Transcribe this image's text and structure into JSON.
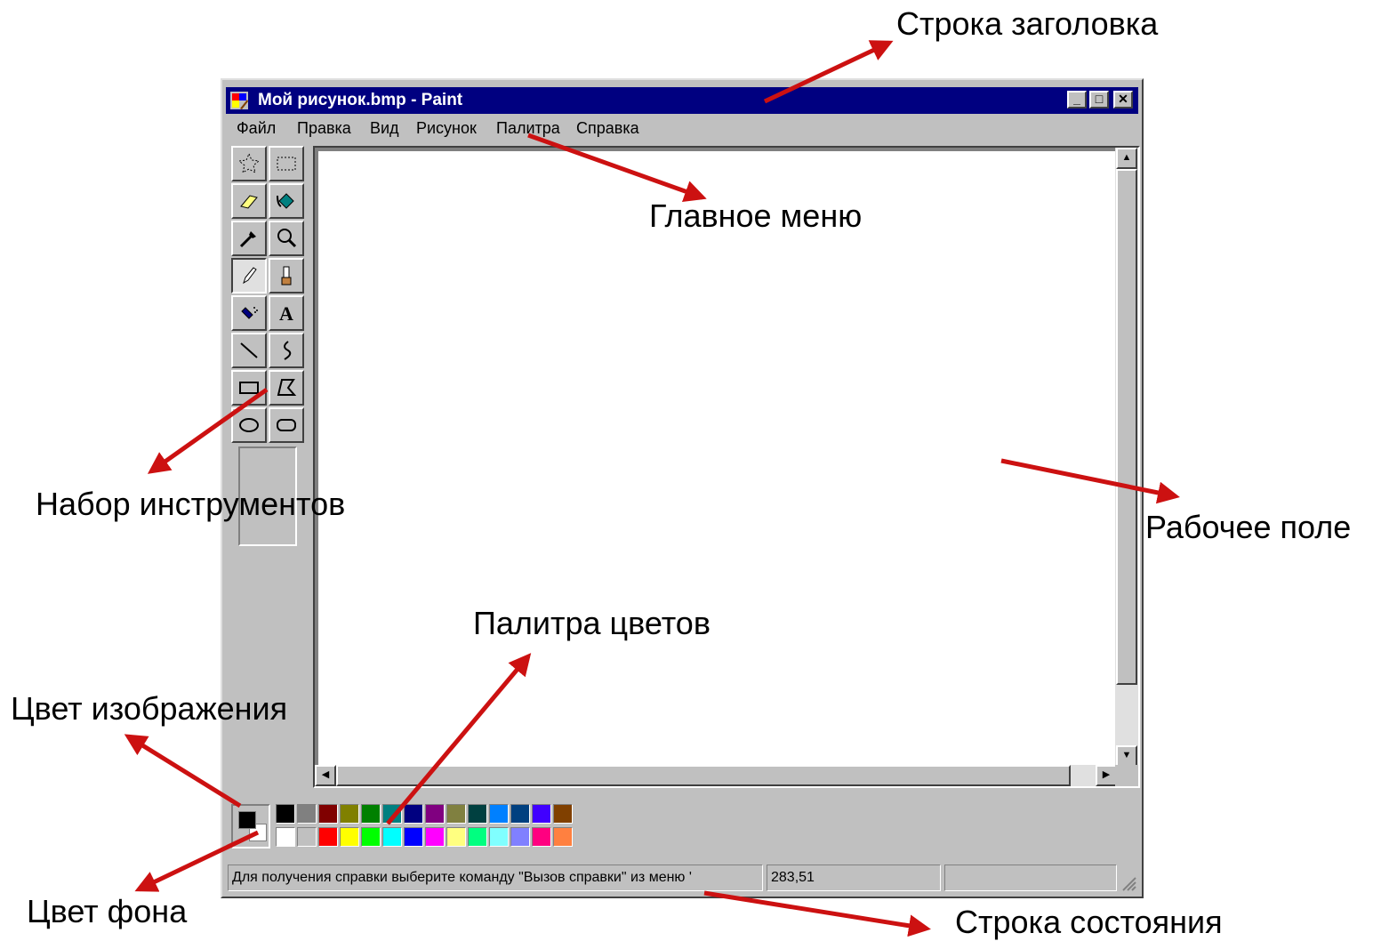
{
  "window": {
    "title": "Мой рисунок.bmp - Paint",
    "controls": {
      "minimize": "_",
      "maximize": "□",
      "close": "✕"
    }
  },
  "menu": [
    "Файл",
    "Правка",
    "Вид",
    "Рисунок",
    "Палитра",
    "Справка"
  ],
  "toolbox": {
    "tools": [
      {
        "name": "free-form-select-icon"
      },
      {
        "name": "rect-select-icon"
      },
      {
        "name": "eraser-icon"
      },
      {
        "name": "fill-bucket-icon"
      },
      {
        "name": "eyedropper-icon"
      },
      {
        "name": "magnifier-icon"
      },
      {
        "name": "pencil-icon",
        "selected": true
      },
      {
        "name": "brush-icon"
      },
      {
        "name": "airbrush-icon"
      },
      {
        "name": "text-icon"
      },
      {
        "name": "line-icon"
      },
      {
        "name": "curve-icon"
      },
      {
        "name": "rectangle-icon"
      },
      {
        "name": "polygon-icon"
      },
      {
        "name": "ellipse-icon"
      },
      {
        "name": "rounded-rect-icon"
      }
    ]
  },
  "palette": {
    "foreground": "#000000",
    "background": "#ffffff",
    "top_row": [
      "#000000",
      "#808080",
      "#800000",
      "#808000",
      "#008000",
      "#008080",
      "#000080",
      "#800080",
      "#808040",
      "#004040",
      "#0080ff",
      "#004080",
      "#4000ff",
      "#804000"
    ],
    "bottom_row": [
      "#ffffff",
      "#c0c0c0",
      "#ff0000",
      "#ffff00",
      "#00ff00",
      "#00ffff",
      "#0000ff",
      "#ff00ff",
      "#ffff80",
      "#00ff80",
      "#80ffff",
      "#8080ff",
      "#ff0080",
      "#ff8040"
    ]
  },
  "status": {
    "help_text": "Для получения справки выберите команду \"Вызов справки\" из меню '",
    "coords": "283,51",
    "size": ""
  },
  "annotations": {
    "title_bar": "Строка  заголовка",
    "main_menu": "Главное меню",
    "toolbox": "Набор инструментов",
    "workspace": "Рабочее поле",
    "palette": "Палитра цветов",
    "image_color": "Цвет изображения",
    "background_color": "Цвет фона",
    "status_bar": "Строка состояния",
    "arrow_color": "#cc1111"
  }
}
